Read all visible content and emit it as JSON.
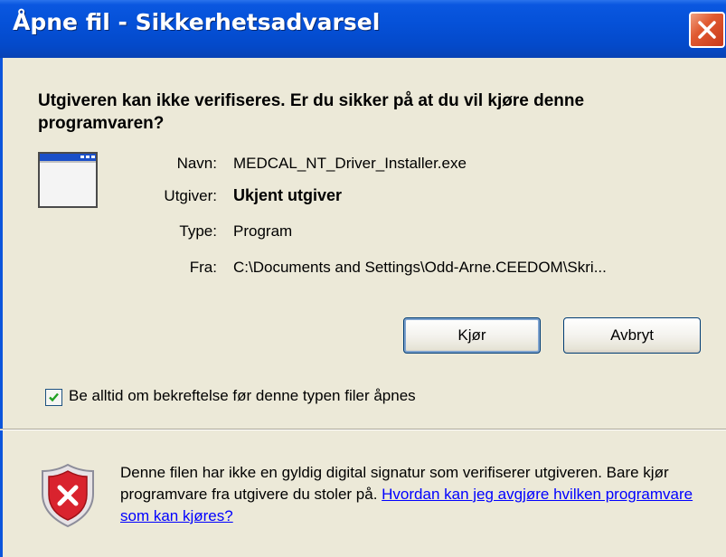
{
  "window": {
    "title": "Åpne fil - Sikkerhetsadvarsel"
  },
  "dialog": {
    "question": "Utgiveren kan ikke verifiseres. Er du sikker på at du vil kjøre denne programvaren?",
    "fields": [
      {
        "label": "Navn:",
        "value": "MEDCAL_NT_Driver_Installer.exe"
      },
      {
        "label": "Utgiver:",
        "value": "Ukjent utgiver"
      },
      {
        "label": "Type:",
        "value": "Program"
      },
      {
        "label": "Fra:",
        "value": "C:\\Documents and Settings\\Odd-Arne.CEEDOM\\Skri..."
      }
    ],
    "buttons": {
      "run": "Kjør",
      "cancel": "Avbryt"
    },
    "checkbox": {
      "label": "Be alltid om bekreftelse før denne typen filer åpnes",
      "checked": true
    },
    "warning": {
      "text": "Denne filen har ikke en gyldig digital signatur som verifiserer utgiveren. Bare kjør programvare fra utgivere du stoler på. ",
      "link": "Hvordan kan jeg avgjøre hvilken programvare som kan kjøres?"
    }
  },
  "icons": {
    "close": "close-icon",
    "application": "application-window-icon",
    "checkmark": "checkmark-icon",
    "shield": "shield-error-icon"
  },
  "colors": {
    "titlebar": "#0551d8",
    "dialog_background": "#ece9d8",
    "close_button": "#e05a30",
    "link": "#0000ff",
    "shield_red": "#d9232e"
  }
}
